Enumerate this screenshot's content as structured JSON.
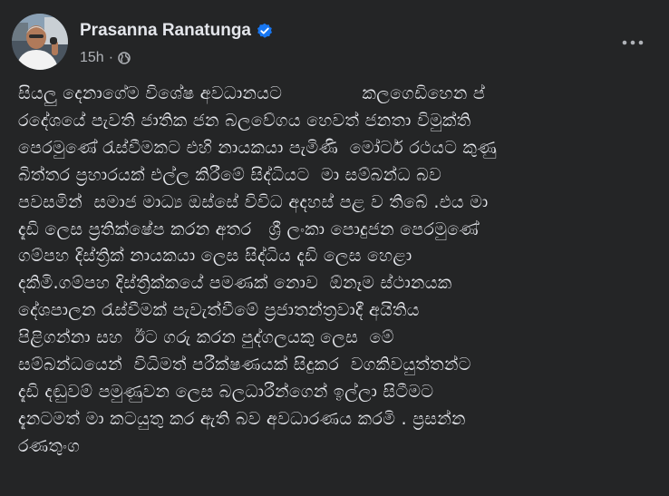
{
  "post": {
    "author_name": "Prasanna Ranatunga",
    "timestamp": "15h",
    "separator": "·",
    "privacy_icon": "globe-icon",
    "verified_icon": "verified-badge-icon",
    "more_icon": "more-options-icon",
    "text": "සියලු දෙනාගේම විශේෂ අවධානයට              කලගෙඩිහෙන ප්\nරදේශයේ පැවති ජාතික ජන බලවේගය හෙවත් ජනතා විමුක්ති\nපෙරමුණේ රැස්වීමකට එහි නායකයා පැමිණි  මෝටර් රථයට කුණු\nබිත්තර ප්‍රහාරයක් එල්ල කිරීමේ සිද්ධියට  මා සම්බන්ධ බව\nපවසමින්  සමාජ මාධ්‍ය ඔස්සේ විවිධ අදහස් පළ ව තිබේ .එය මා\nදැඩි ලෙස ප්‍රතික්ෂේප කරන අතර   ශ්‍රී ලංකා පොදුජන පෙරමුණේ\nගම්පහ දිස්ත්‍රික් නායකයා ලෙස සිද්ධිය දැඩි ලෙස හෙළා\nදකිමි.ගම්පහ දිස්ත්‍රික්කයේ පමණක් නොව  ඕනෑම ස්ථානයක\nදේශපාලන රැස්වීමක් පැවැත්වීමේ ප්‍රජාතන්ත්‍රවාදී අයිතිය\nපිළිගන්නා සහ  ඊට ගරු කරන පුද්ගලයකු ලෙස  මේ\nසම්බන්ධයෙන්  විධිමත් පරීක්ෂණයක් සිදුකර  වගකිවයුත්තන්ට\nදැඩි දඬුවම් පමුණුවන ලෙස බලධාරීන්ගෙන් ඉල්ලා සිටීමට\nදැනටමත් මා කටයුතු කර ඇති බව අවධාරණය කරමි . ප්‍රසන්න\nරණතුංග"
  },
  "colors": {
    "background": "#242526",
    "primary_text": "#e4e6eb",
    "secondary_text": "#b0b3b8",
    "verified_blue": "#1877f2"
  }
}
